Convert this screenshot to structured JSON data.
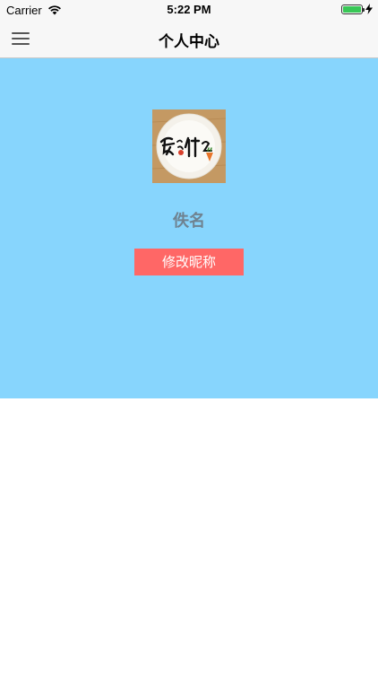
{
  "status_bar": {
    "carrier": "Carrier",
    "time": "5:22 PM",
    "battery_color": "#38c756"
  },
  "nav": {
    "title": "个人中心",
    "menu_icon": "hamburger-menu-icon"
  },
  "profile": {
    "panel_color": "#87d5fd",
    "avatar_logo_text": "爱吃什么",
    "username": "佚名",
    "edit_button_label": "修改昵称",
    "edit_button_color": "#ff6766"
  }
}
